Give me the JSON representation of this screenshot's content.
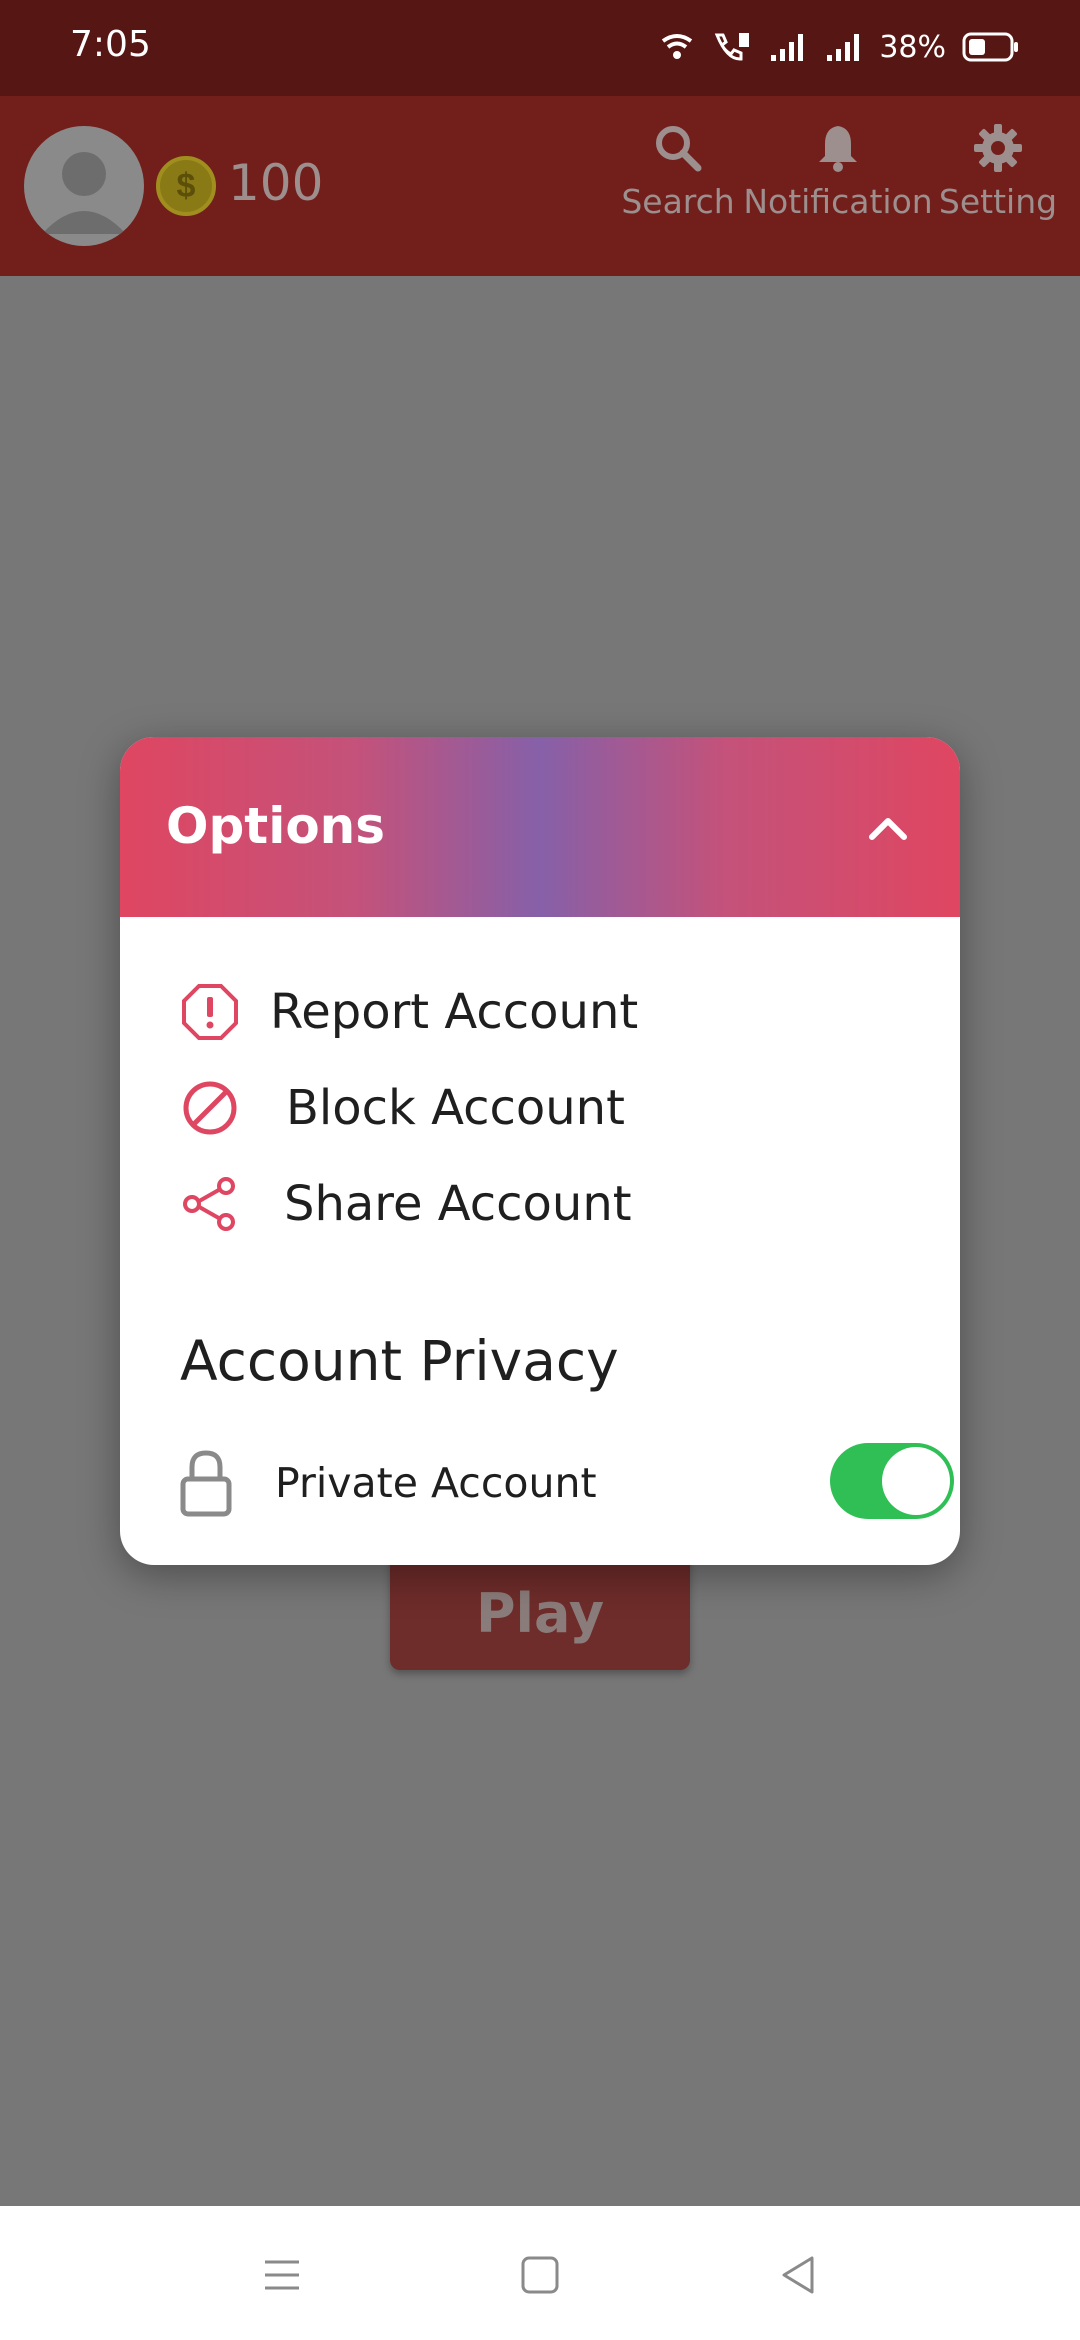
{
  "status_bar": {
    "time": "7:05",
    "battery": "38%",
    "icons": [
      "wifi-icon",
      "volte-call-icon",
      "signal-sim1-icon",
      "signal-sim2-icon",
      "battery-icon"
    ]
  },
  "app_bar": {
    "coin_symbol": "$",
    "coins": "100",
    "actions": [
      {
        "icon": "search-icon",
        "label": "Search"
      },
      {
        "icon": "bell-icon",
        "label": "Notification"
      },
      {
        "icon": "gear-icon",
        "label": "Setting"
      }
    ]
  },
  "background": {
    "play_label": "Play"
  },
  "dialog": {
    "title": "Options",
    "collapse_icon": "chevron-up-icon",
    "options": [
      {
        "icon": "report-icon",
        "label": "Report Account"
      },
      {
        "icon": "block-icon",
        "label": "Block Account"
      },
      {
        "icon": "share-icon",
        "label": "Share Account"
      }
    ],
    "privacy_heading": "Account Privacy",
    "private_account": {
      "icon": "lock-icon",
      "label": "Private Account",
      "enabled": true
    }
  },
  "colors": {
    "accent": "#df4661",
    "header_mid": "#8660a8",
    "toggle_on": "#2fbf55"
  },
  "system_nav": [
    "menu-icon",
    "home-icon",
    "back-icon"
  ]
}
